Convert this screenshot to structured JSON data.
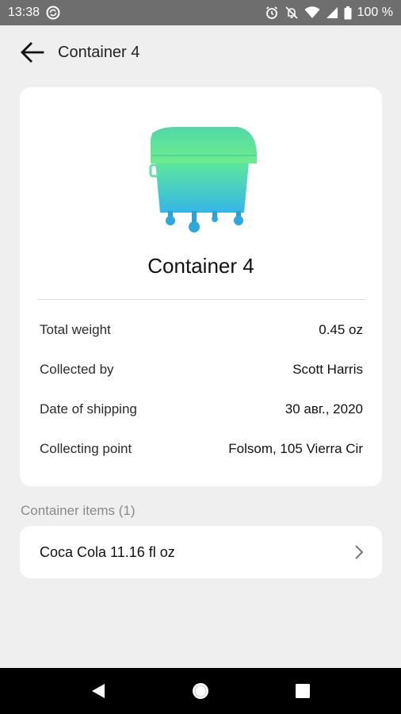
{
  "status_bar": {
    "time": "13:38",
    "battery": "100 %",
    "icons": [
      "sync-icon",
      "alarm-icon",
      "mute-icon",
      "wifi-icon",
      "signal-icon",
      "battery-icon"
    ]
  },
  "app_bar": {
    "title": "Container 4",
    "back_icon": "arrow-back-icon"
  },
  "card": {
    "image_icon": "waste-container-icon",
    "title": "Container 4",
    "details": [
      {
        "label": "Total weight",
        "value": "0.45 oz"
      },
      {
        "label": "Collected by",
        "value": "Scott Harris"
      },
      {
        "label": "Date of shipping",
        "value": "30 авг., 2020"
      },
      {
        "label": "Collecting point",
        "value": "Folsom, 105 Vierra Cir"
      }
    ]
  },
  "items_section": {
    "title": "Container items (1)",
    "items": [
      {
        "label": "Coca Cola 11.16 fl oz",
        "icon": "chevron-right-icon"
      }
    ]
  },
  "nav_bar": {
    "icons": [
      "back-triangle-icon",
      "home-circle-icon",
      "recents-square-icon"
    ]
  },
  "colors": {
    "background": "#efefef",
    "card": "#ffffff",
    "status_bar": "#6e6e6e",
    "nav_bar": "#000000",
    "container_top": "#5ee89a",
    "container_bottom": "#35b6e8"
  }
}
